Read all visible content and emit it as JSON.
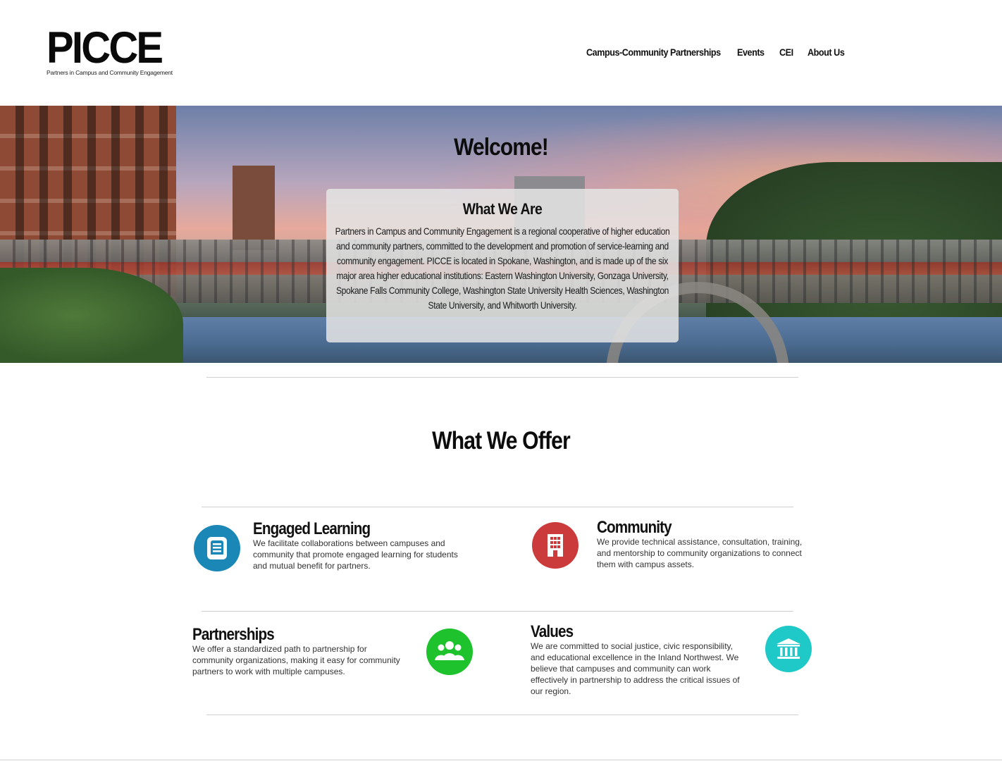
{
  "header": {
    "logo_text": "PICCE",
    "logo_subtitle": "Partners in Campus and Community Engagement",
    "nav": [
      {
        "label": "Campus-Community Partnerships"
      },
      {
        "label": "Events"
      },
      {
        "label": "CEI"
      },
      {
        "label": "About Us"
      }
    ]
  },
  "hero": {
    "title": "Welcome!",
    "about_title": "What We Are",
    "about_text": "Partners in Campus and Community Engagement is a regional cooperative of higher education and community partners, committed to the development and promotion of service-learning and community engagement. PICCE is located in Spokane, Washington, and is made up of the six major area higher educational institutions: Eastern Washington University, Gonzaga University, Spokane Falls Community College, Washington State University Health Sciences, Washington State University, and Whitworth University."
  },
  "offer": {
    "title": "What We Offer",
    "features": [
      {
        "title": "Engaged Learning",
        "text": "We facilitate collaborations between campuses and community that promote engaged learning for students and mutual benefit for partners.",
        "icon": "book-icon",
        "color": "#1b87b6"
      },
      {
        "title": "Community",
        "text": "We provide technical assistance, consultation, training, and mentorship to community organizations to connect them with campus assets.",
        "icon": "building-icon",
        "color": "#cc3b3b"
      },
      {
        "title": "Partnerships",
        "text": "We offer a standardized path to partnership for community organizations, making it easy for community partners to work with multiple campuses.",
        "icon": "people-icon",
        "color": "#1ec22c"
      },
      {
        "title": "Values",
        "text": "We are committed to social justice, civic responsibility, and educational excellence in the Inland Northwest. We believe that campuses and community can work effectively in partnership to address the critical issues of our region.",
        "icon": "institution-icon",
        "color": "#1fc9c7"
      }
    ]
  }
}
